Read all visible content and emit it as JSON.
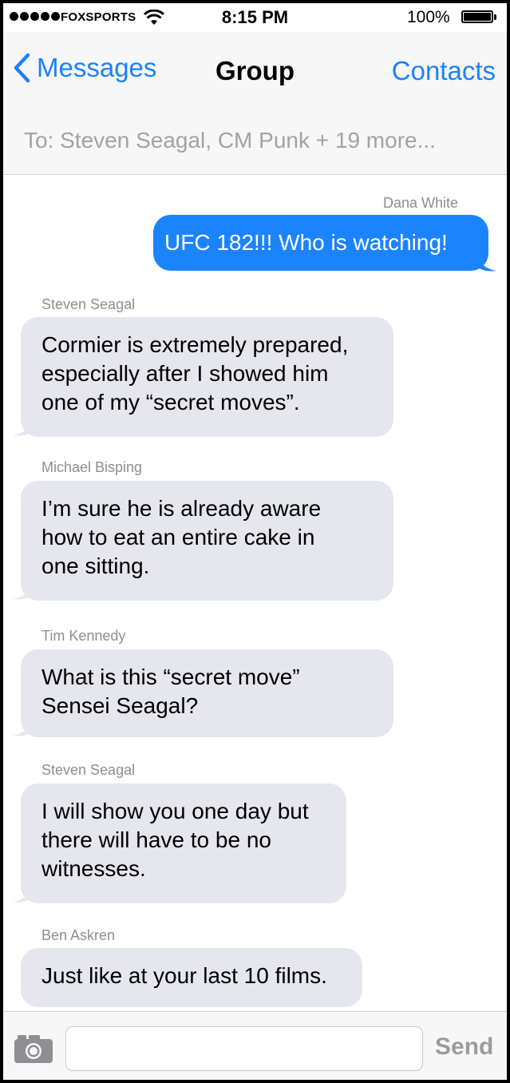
{
  "status_bar": {
    "carrier": "FOXSPORTS",
    "time": "8:15 PM",
    "battery_percent": "100%"
  },
  "nav": {
    "back_label": "Messages",
    "title": "Group",
    "contacts_label": "Contacts"
  },
  "to_field": {
    "text": "To: Steven Seagal, CM Punk + 19 more..."
  },
  "messages": [
    {
      "sender": "Dana White",
      "direction": "outgoing",
      "lines": [
        "UFC 182!!! Who is watching!"
      ]
    },
    {
      "sender": "Steven Seagal",
      "direction": "incoming",
      "lines": [
        "Cormier is extremely prepared,",
        "especially after I showed him",
        "one of my “secret moves”."
      ]
    },
    {
      "sender": "Michael Bisping",
      "direction": "incoming",
      "lines": [
        "I’m sure he is already aware",
        "how to eat an entire cake in",
        "one sitting."
      ]
    },
    {
      "sender": "Tim Kennedy",
      "direction": "incoming",
      "lines": [
        "What is this “secret move”",
        "Sensei Seagal?"
      ]
    },
    {
      "sender": "Steven Seagal",
      "direction": "incoming",
      "lines": [
        "I will show you one day but",
        "there will have to be no",
        "witnesses."
      ]
    },
    {
      "sender": "Ben Askren",
      "direction": "incoming",
      "lines": [
        "Just like at your last 10 films."
      ]
    }
  ],
  "input_bar": {
    "placeholder": "",
    "send_label": "Send"
  },
  "colors": {
    "accent": "#1a82fb",
    "outgoing_bubble": "#1b84fd",
    "incoming_bubble": "#e5e6ee"
  },
  "icons": [
    "signal-dots-icon",
    "wifi-icon",
    "battery-icon",
    "chevron-left-icon",
    "camera-icon"
  ]
}
